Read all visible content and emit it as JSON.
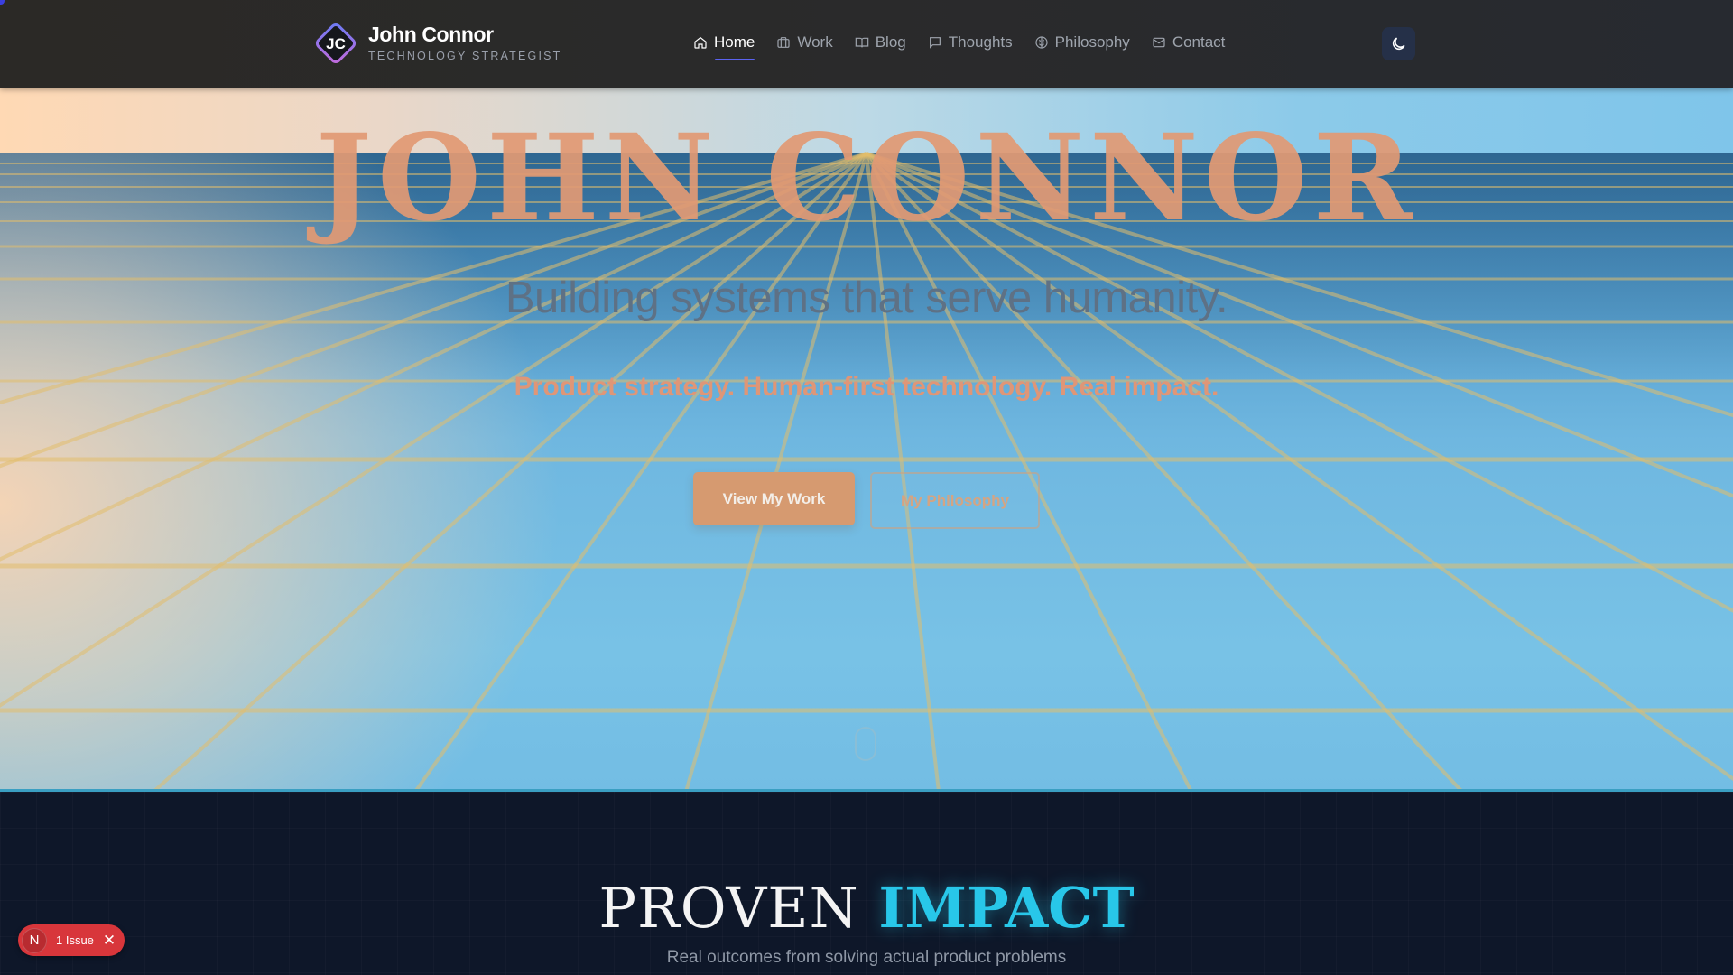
{
  "nav": {
    "logo_initials": "JC",
    "brand_name": "John Connor",
    "brand_subtitle": "TECHNOLOGY STRATEGIST",
    "items": [
      {
        "label": "Home",
        "icon": "home-icon",
        "active": true
      },
      {
        "label": "Work",
        "icon": "briefcase-icon",
        "active": false
      },
      {
        "label": "Blog",
        "icon": "book-icon",
        "active": false
      },
      {
        "label": "Thoughts",
        "icon": "chat-bubble-icon",
        "active": false
      },
      {
        "label": "Philosophy",
        "icon": "brain-icon",
        "active": false
      },
      {
        "label": "Contact",
        "icon": "mail-icon",
        "active": false
      }
    ],
    "theme_toggle_icon": "moon-icon"
  },
  "hero": {
    "title": "JOHN CONNOR",
    "subtitle": "Building systems that serve humanity.",
    "tagline": "Product strategy. Human-first technology. Real impact.",
    "primary_button": "View My Work",
    "secondary_button": "My Philosophy"
  },
  "impact": {
    "title_part1": "PROVEN",
    "title_part2": "IMPACT",
    "subtitle": "Real outcomes from solving actual product problems"
  },
  "dev_badge": {
    "logo": "N",
    "label": "1 Issue",
    "close": "✕"
  },
  "colors": {
    "accent_cyan": "#28c7e9",
    "accent_indigo": "#5b63f0",
    "hero_title": "#e29a74",
    "badge_red": "#d8363b"
  }
}
